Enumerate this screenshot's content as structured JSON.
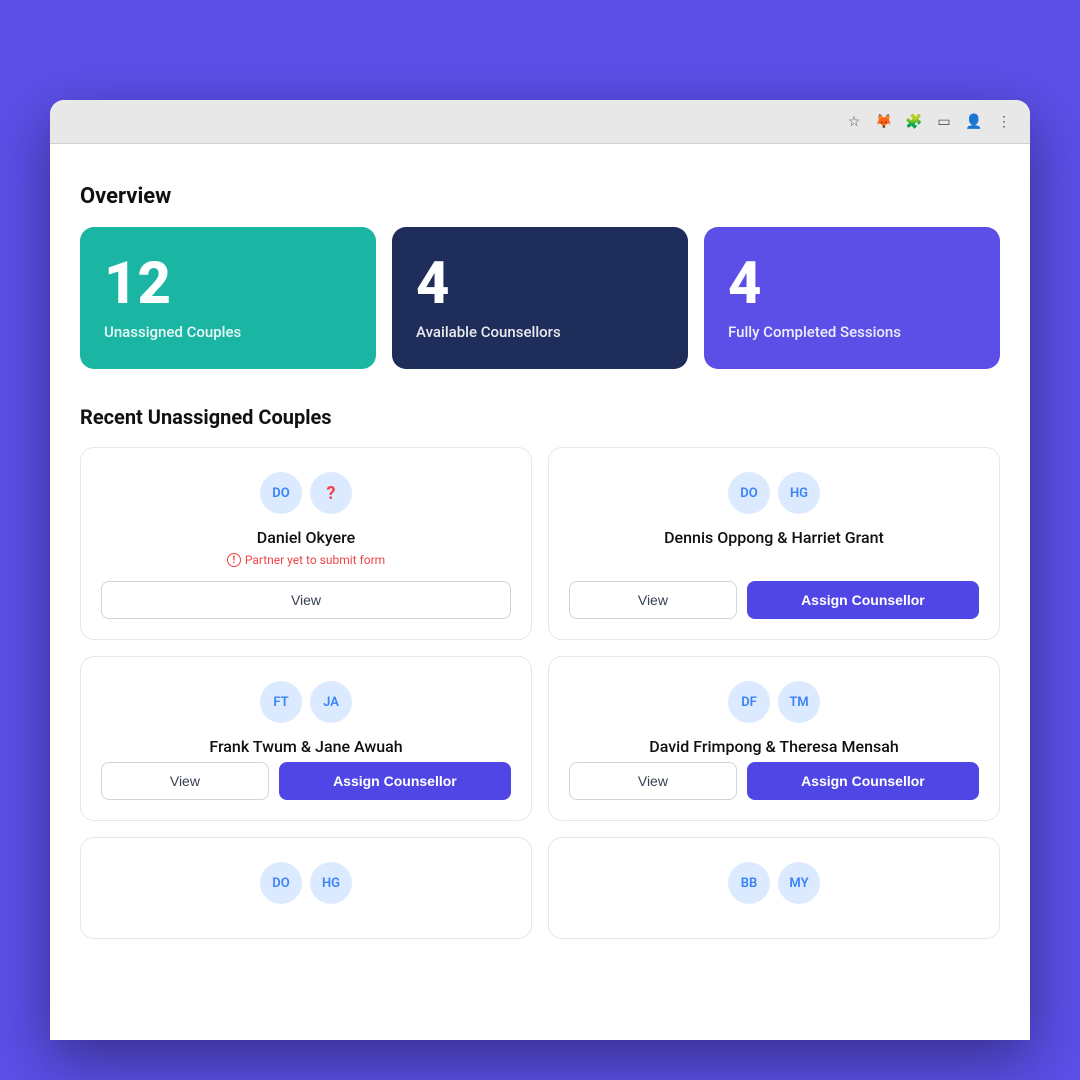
{
  "browser": {
    "toolbar_icons": [
      "star",
      "fox",
      "puzzle",
      "tab",
      "avatar",
      "menu"
    ]
  },
  "overview": {
    "title": "Overview",
    "stats": [
      {
        "number": "12",
        "label": "Unassigned Couples",
        "color": "teal"
      },
      {
        "number": "4",
        "label": "Available Counsellors",
        "color": "dark-blue"
      },
      {
        "number": "4",
        "label": "Fully Completed Sessions",
        "color": "purple"
      }
    ]
  },
  "recent_section": {
    "title": "Recent Unassigned Couples"
  },
  "couples": [
    {
      "id": "card-1",
      "avatars": [
        {
          "initials": "DO",
          "type": "normal"
        },
        {
          "initials": "?",
          "type": "question"
        }
      ],
      "name": "Daniel Okyere",
      "warning": "Partner yet to submit form",
      "show_warning": true,
      "show_assign": false,
      "view_label": "View",
      "assign_label": "Assign Counsellor"
    },
    {
      "id": "card-2",
      "avatars": [
        {
          "initials": "DO",
          "type": "normal"
        },
        {
          "initials": "HG",
          "type": "normal"
        }
      ],
      "name": "Dennis Oppong & Harriet Grant",
      "warning": "",
      "show_warning": false,
      "show_assign": true,
      "view_label": "View",
      "assign_label": "Assign Counsellor"
    },
    {
      "id": "card-3",
      "avatars": [
        {
          "initials": "FT",
          "type": "normal"
        },
        {
          "initials": "JA",
          "type": "normal"
        }
      ],
      "name": "Frank Twum & Jane Awuah",
      "warning": "",
      "show_warning": false,
      "show_assign": true,
      "view_label": "View",
      "assign_label": "Assign Counsellor"
    },
    {
      "id": "card-4",
      "avatars": [
        {
          "initials": "DF",
          "type": "normal"
        },
        {
          "initials": "TM",
          "type": "normal"
        }
      ],
      "name": "David Frimpong & Theresa Mensah",
      "warning": "",
      "show_warning": false,
      "show_assign": true,
      "view_label": "View",
      "assign_label": "Assign Counsellor"
    },
    {
      "id": "card-5",
      "avatars": [
        {
          "initials": "DO",
          "type": "normal"
        },
        {
          "initials": "HG",
          "type": "normal"
        }
      ],
      "name": "",
      "partial": true
    },
    {
      "id": "card-6",
      "avatars": [
        {
          "initials": "BB",
          "type": "normal"
        },
        {
          "initials": "MY",
          "type": "normal"
        }
      ],
      "name": "",
      "partial": true
    }
  ],
  "labels": {
    "overview": "Overview",
    "recent": "Recent Unassigned Couples",
    "view": "View",
    "assign": "Assign Counsellor",
    "warning": "Partner yet to submit form"
  }
}
